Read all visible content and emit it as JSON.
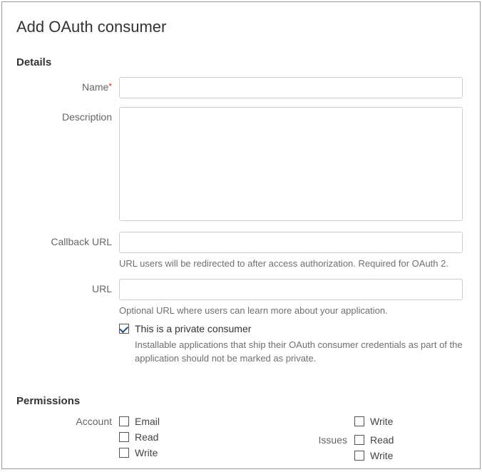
{
  "title": "Add OAuth consumer",
  "sections": {
    "details": "Details",
    "permissions": "Permissions"
  },
  "fields": {
    "name": {
      "label": "Name",
      "required": true,
      "value": ""
    },
    "description": {
      "label": "Description",
      "value": ""
    },
    "callback": {
      "label": "Callback URL",
      "value": "",
      "help": "URL users will be redirected to after access authorization. Required for OAuth 2."
    },
    "url": {
      "label": "URL",
      "value": "",
      "help": "Optional URL where users can learn more about your application."
    },
    "private": {
      "label": "This is a private consumer",
      "checked": true,
      "help": "Installable applications that ship their OAuth consumer credentials as part of the application should not be marked as private."
    }
  },
  "permissions": {
    "account": {
      "label": "Account",
      "options": [
        {
          "key": "email",
          "label": "Email",
          "checked": false
        },
        {
          "key": "read",
          "label": "Read",
          "checked": false
        },
        {
          "key": "write",
          "label": "Write",
          "checked": false
        }
      ]
    },
    "col2top": {
      "options": [
        {
          "key": "write",
          "label": "Write",
          "checked": false
        }
      ]
    },
    "issues": {
      "label": "Issues",
      "options": [
        {
          "key": "read",
          "label": "Read",
          "checked": false
        },
        {
          "key": "write",
          "label": "Write",
          "checked": false
        }
      ]
    }
  }
}
